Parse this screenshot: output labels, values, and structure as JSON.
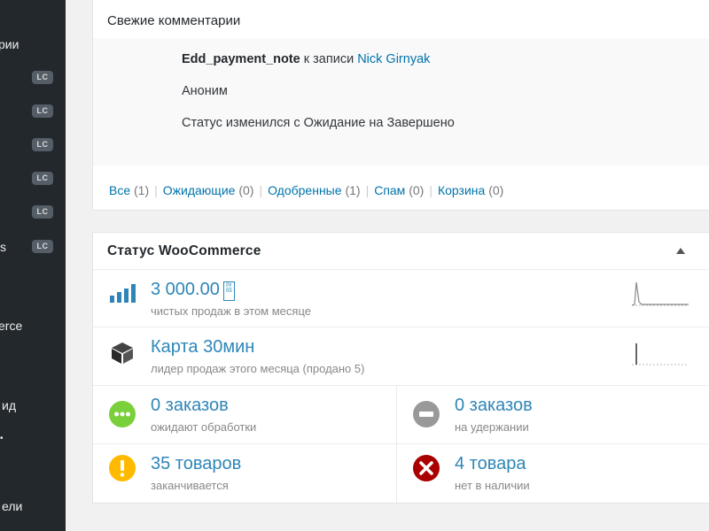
{
  "sidebar": {
    "items": [
      {
        "label": "рии"
      },
      {
        "label": "s"
      },
      {
        "label": "erce"
      },
      {
        "label": "ид"
      },
      {
        "label": "ели"
      }
    ],
    "badge_label": "LC"
  },
  "comments": {
    "title": "Свежие комментарии",
    "note_author": "Edd_payment_note",
    "note_to": "к записи",
    "note_post": "Nick Girnyak",
    "author": "Аноним",
    "text": "Статус изменился с Ожидание на Завершено",
    "filters": [
      {
        "label": "Все",
        "count": "(1)"
      },
      {
        "label": "Ожидающие",
        "count": "(0)"
      },
      {
        "label": "Одобренные",
        "count": "(1)"
      },
      {
        "label": "Спам",
        "count": "(0)"
      },
      {
        "label": "Корзина",
        "count": "(0)"
      }
    ]
  },
  "woo": {
    "title": "Статус WooCommerce",
    "net_sales_value": "3 000.00",
    "currency_glyph_top": "py",
    "currency_glyph_bottom": "бб",
    "net_sales_label": "чистых продаж в этом месяце",
    "top_seller_name": "Карта 30мин",
    "top_seller_label": "лидер продаж этого месяца (продано 5)",
    "processing_value": "0 заказов",
    "processing_label": "ожидают обработки",
    "onhold_value": "0 заказов",
    "onhold_label": "на удержании",
    "lowstock_value": "35 товаров",
    "lowstock_label": "заканчивается",
    "outstock_value": "4 товара",
    "outstock_label": "нет в наличии"
  },
  "colors": {
    "link": "#0073aa",
    "stat_value": "#2e86b8",
    "processing": "#7ad03a",
    "onhold": "#999999",
    "lowstock": "#ffba00",
    "outstock": "#a00000"
  }
}
